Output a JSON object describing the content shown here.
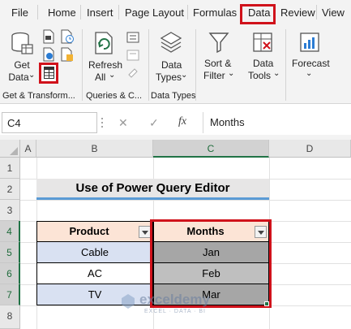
{
  "tabs": [
    "File",
    "Home",
    "Insert",
    "Page Layout",
    "Formulas",
    "Data",
    "Review",
    "View"
  ],
  "active_tab": "Data",
  "colors": {
    "highlight": "#d0121b",
    "excel_green": "#217346",
    "header_fill": "#fce4d6",
    "title_underline": "#5b9bd5",
    "data_fill": "#d9e1f2",
    "selected_fill": "#a6a6a6"
  },
  "ribbon": {
    "get_data": {
      "line1": "Get",
      "line2": "Data",
      "arrow": "⌄"
    },
    "refresh_all": {
      "line1": "Refresh",
      "line2": "All",
      "arrow": "⌄"
    },
    "data_types": {
      "line1": "Data",
      "line2": "Types",
      "arrow": "⌄"
    },
    "sort_filter": {
      "line1": "Sort &",
      "line2": "Filter",
      "arrow": "⌄"
    },
    "data_tools": {
      "line1": "Data",
      "line2": "Tools",
      "arrow": "⌄"
    },
    "forecast": {
      "line1": "Forecast",
      "arrow": "⌄"
    },
    "groups": {
      "get_transform": "Get & Transform...",
      "queries": "Queries & C...",
      "data_types": "Data Types"
    }
  },
  "formula_bar": {
    "name_box": "C4",
    "cancel": "✕",
    "confirm": "✓",
    "fx": "fx",
    "value": "Months"
  },
  "columns": [
    "A",
    "B",
    "C",
    "D"
  ],
  "rows": [
    "1",
    "2",
    "3",
    "4",
    "5",
    "6",
    "7",
    "8"
  ],
  "sheet": {
    "title": "Use of Power Query Editor",
    "headers": {
      "product": "Product",
      "months": "Months"
    },
    "products": [
      "Cable",
      "AC",
      "TV"
    ],
    "months": [
      "Jan",
      "Feb",
      "Mar"
    ]
  },
  "watermark": {
    "name": "exceldemy",
    "tagline": "EXCEL · DATA · BI"
  }
}
